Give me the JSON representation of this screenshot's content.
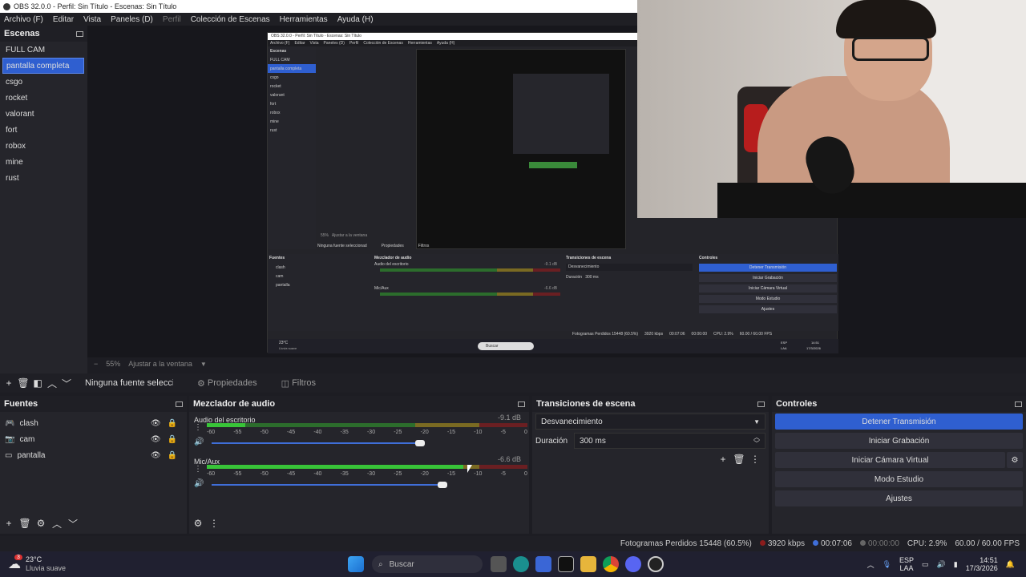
{
  "window": {
    "title": "OBS 32.0.0 - Perfil: Sin Título - Escenas: Sin Título"
  },
  "menu": [
    "Archivo (F)",
    "Editar",
    "Vista",
    "Paneles (D)",
    "Perfil",
    "Colección de Escenas",
    "Herramientas",
    "Ayuda (H)"
  ],
  "scenes": {
    "title": "Escenas",
    "items": [
      "FULL CAM",
      "pantalla completa",
      "csgo",
      "rocket",
      "valorant",
      "fort",
      "robox",
      "mine",
      "rust"
    ],
    "selected": "pantalla completa"
  },
  "zoom": {
    "minus": "−",
    "value": "55%",
    "fit": "Ajustar a la ventana"
  },
  "sourcebar": {
    "no_source": "Ninguna fuente seleccionad",
    "properties": "Propiedades",
    "filters": "Filtros"
  },
  "sources": {
    "title": "Fuentes",
    "items": [
      {
        "name": "clash",
        "icon": "gamepad-icon"
      },
      {
        "name": "cam",
        "icon": "camera-icon"
      },
      {
        "name": "pantalla",
        "icon": "monitor-icon"
      }
    ]
  },
  "mixer": {
    "title": "Mezclador de audio",
    "channels": [
      {
        "name": "Audio del escritorio",
        "db": "-9.1 dB",
        "level": 0.12,
        "peak": 0.35,
        "fader": 0.65
      },
      {
        "name": "Mic/Aux",
        "db": "-6.6 dB",
        "level": 0.8,
        "peak": 0.82,
        "fader": 0.72
      }
    ],
    "ticks": [
      "-60",
      "-55",
      "-50",
      "-45",
      "-40",
      "-35",
      "-30",
      "-25",
      "-20",
      "-15",
      "-10",
      "-5",
      "0"
    ]
  },
  "transitions": {
    "title": "Transiciones de escena",
    "selected": "Desvanecimiento",
    "duration_label": "Duración",
    "duration_value": "300 ms"
  },
  "controls": {
    "title": "Controles",
    "stop_stream": "Detener Transmisión",
    "start_record": "Iniciar Grabación",
    "virtual_cam": "Iniciar Cámara Virtual",
    "studio_mode": "Modo Estudio",
    "settings": "Ajustes"
  },
  "status": {
    "dropped": "Fotogramas Perdidos 15448 (60.5%)",
    "bitrate": "3920 kbps",
    "stream_time": "00:07:06",
    "rec_time": "00:00:00",
    "cpu": "CPU: 2.9%",
    "fps": "60.00 / 60.00 FPS"
  },
  "taskbar": {
    "weather_temp": "23°C",
    "weather_desc": "Lluvia suave",
    "weather_badge": "3",
    "search": "Buscar",
    "lang1": "ESP",
    "lang2": "LAA",
    "time": "14:51",
    "date": "17/3/2026"
  },
  "nested": {
    "title": "OBS 32.0.0 - Perfil: Sin Título - Escenas: Sin Título",
    "menu": [
      "Archivo (F)",
      "Editar",
      "Vista",
      "Paneles (D)",
      "Perfil",
      "Colección de Escenas",
      "Herramientas",
      "Ayuda (H)"
    ],
    "scenes_title": "Escenas",
    "sources": [
      "clash",
      "cam",
      "pantalla"
    ],
    "no_source": "Ninguna fuente seleccionad",
    "properties": "Propiedades",
    "filters": "Filtros",
    "zoom": "55%",
    "fit": "Ajustar a la ventana",
    "fuentes": "Fuentes",
    "mixer": "Mezclador de audio",
    "audio1": "Audio del escritorio",
    "audio2": "Mic/Aux",
    "db1": "-9.1 dB",
    "db2": "-6.6 dB",
    "trans": "Transiciones de escena",
    "fade": "Desvanecimiento",
    "dur": "Duración",
    "dur_val": "300 ms",
    "controls": "Controles",
    "stop": "Detener Transmisión",
    "rec": "Iniciar Grabación",
    "vcam": "Iniciar Cámara Virtual",
    "studio": "Modo Estudio",
    "settings": "Ajustes",
    "status": "Fotogramas Perdidos 15448 (60.5%)",
    "kbps": "3920 kbps",
    "t1": "00:07:06",
    "t2": "00:00:00",
    "cpu": "CPU: 2.9%",
    "fps": "60.00 / 60.00 FPS",
    "temp": "23°C",
    "wdesc": "Lluvia suave",
    "search": "Buscar",
    "lang1": "ESP",
    "lang2": "LAA",
    "time": "14:51",
    "date": "17/3/2026"
  },
  "colors": {
    "accent": "#2f5fd0",
    "meter_green": "#38c438",
    "dock_bg": "#25252b"
  }
}
